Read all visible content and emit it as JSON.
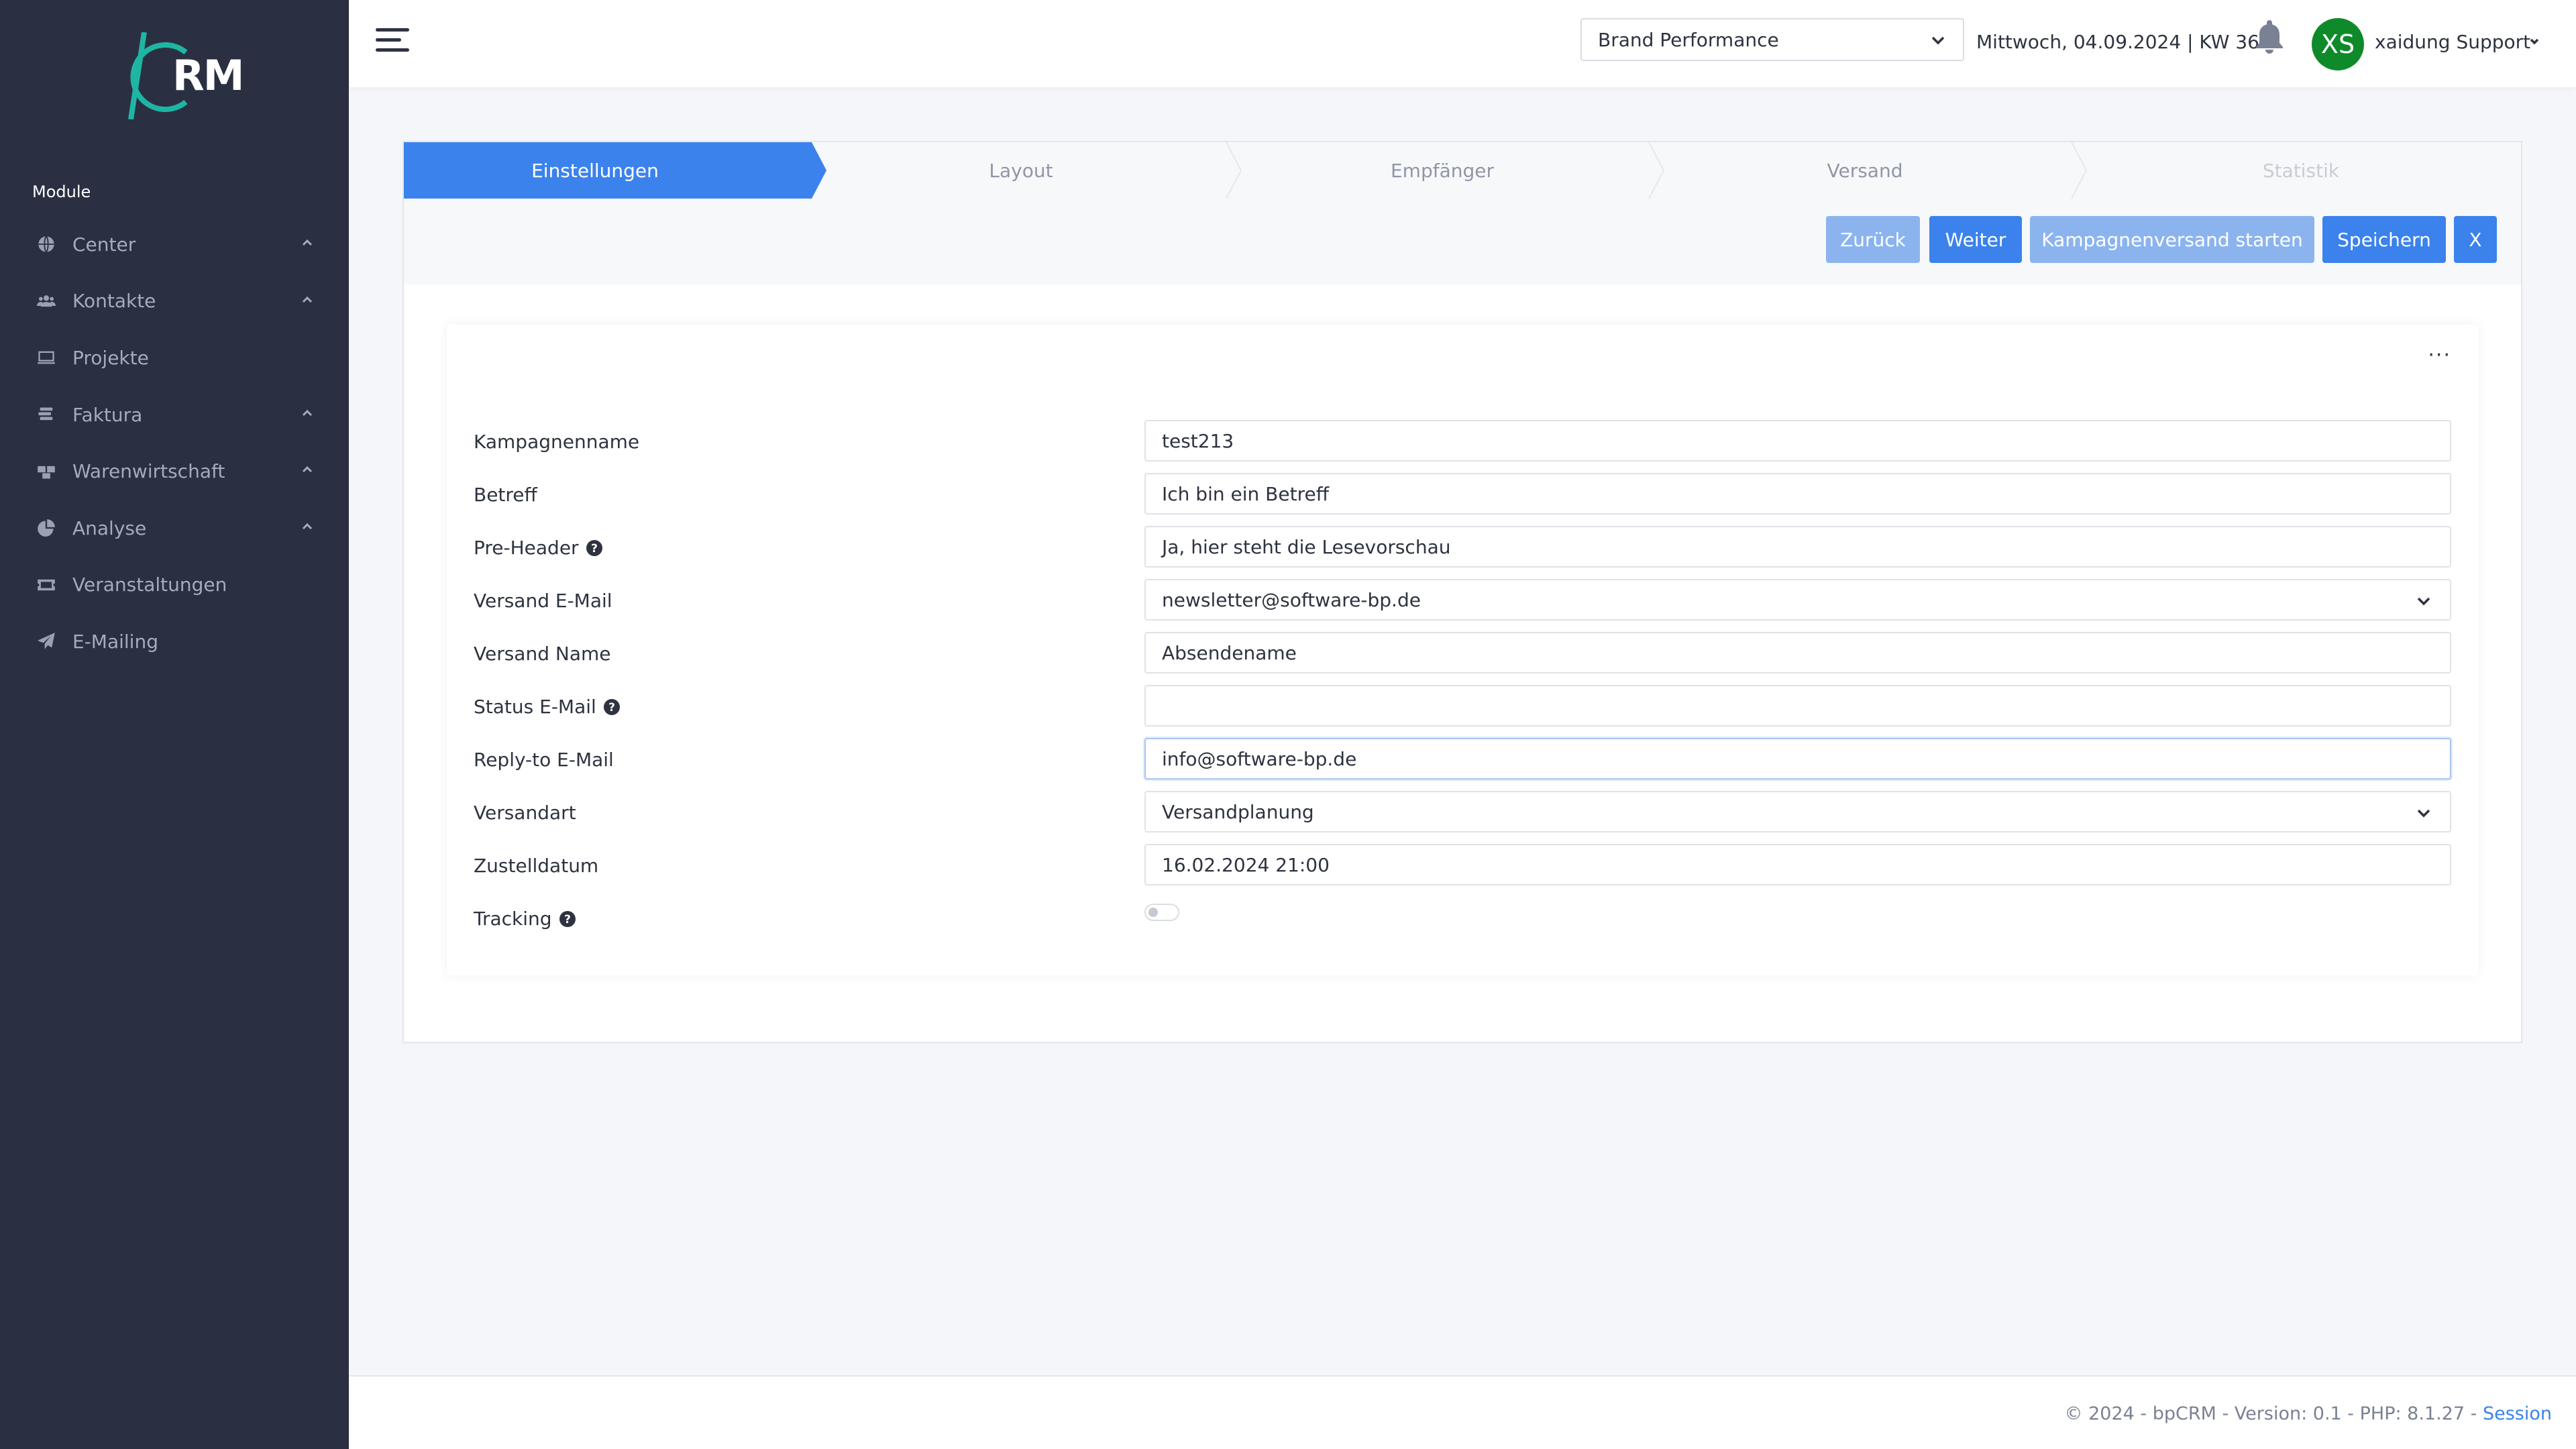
{
  "sidebar": {
    "logo_text": "RM",
    "module_label": "Module",
    "items": [
      {
        "label": "Center",
        "icon": "globe-icon",
        "expandable": true
      },
      {
        "label": "Kontakte",
        "icon": "users-icon",
        "expandable": true
      },
      {
        "label": "Projekte",
        "icon": "book-icon",
        "expandable": false
      },
      {
        "label": "Faktura",
        "icon": "coins-icon",
        "expandable": true
      },
      {
        "label": "Warenwirtschaft",
        "icon": "boxes-icon",
        "expandable": true
      },
      {
        "label": "Analyse",
        "icon": "pie-chart-icon",
        "expandable": true
      },
      {
        "label": "Veranstaltungen",
        "icon": "ticket-icon",
        "expandable": false
      },
      {
        "label": "E-Mailing",
        "icon": "paper-plane-icon",
        "expandable": false
      }
    ]
  },
  "header": {
    "company_select": "Brand Performance",
    "date_info": "Mittwoch, 04.09.2024 | KW 36",
    "avatar_initials": "XS",
    "user_name": "xaidung Support"
  },
  "wizard": {
    "steps": [
      "Einstellungen",
      "Layout",
      "Empfänger",
      "Versand",
      "Statistik"
    ],
    "active_step": 0,
    "buttons": {
      "back": "Zurück",
      "next": "Weiter",
      "start": "Kampagnenversand starten",
      "save": "Speichern",
      "close": "X"
    }
  },
  "form": {
    "menu": "···",
    "fields": {
      "campaign_name": {
        "label": "Kampagnenname",
        "value": "test213"
      },
      "subject": {
        "label": "Betreff",
        "value": "Ich bin ein Betreff"
      },
      "preheader": {
        "label": "Pre-Header",
        "value": "Ja, hier steht die Lesevorschau"
      },
      "sender_email": {
        "label": "Versand E-Mail",
        "value": "newsletter@software-bp.de"
      },
      "sender_name": {
        "label": "Versand Name",
        "value": "Absendename"
      },
      "status_email": {
        "label": "Status E-Mail",
        "value": ""
      },
      "reply_to": {
        "label": "Reply-to E-Mail",
        "value": "info@software-bp.de"
      },
      "shipping_type": {
        "label": "Versandart",
        "value": "Versandplanung"
      },
      "delivery_date": {
        "label": "Zustelldatum",
        "value": "16.02.2024 21:00"
      },
      "tracking": {
        "label": "Tracking",
        "enabled": false
      }
    }
  },
  "footer": {
    "text": "© 2024 - bpCRM - Version: 0.1 - PHP: 8.1.27 - ",
    "session_link": "Session"
  },
  "colors": {
    "sidebar_bg": "#2a3042",
    "accent": "#3b82ec",
    "accent_light": "#8bb4ef",
    "avatar_bg": "#0f8a2a",
    "logo_teal": "#1fb5a3"
  }
}
